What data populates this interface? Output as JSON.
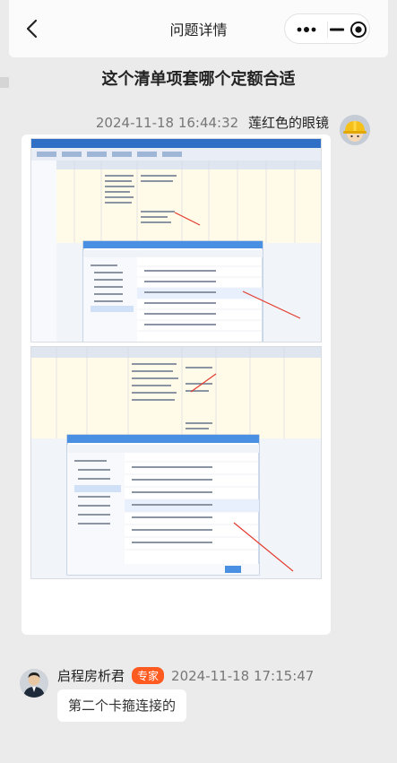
{
  "navbar": {
    "title": "问题详情",
    "back_icon": "chevron-left-icon",
    "more_icon": "more-dots-icon",
    "minimize_icon": "minus-icon",
    "close_icon": "target-circle-icon"
  },
  "question": {
    "title": "这个清单项套哪个定额合适"
  },
  "messages": [
    {
      "timestamp": "2024-11-18 16:44:32",
      "author": "莲红色的眼镜",
      "avatar_icon": "hardhat-avatar-icon",
      "attachment": "image"
    },
    {
      "author": "启程房析君",
      "badge": "专家",
      "timestamp": "2024-11-18 17:15:47",
      "avatar_icon": "person-avatar-icon",
      "text": "第二个卡箍连接的"
    }
  ],
  "colors": {
    "accent": "#ff5a1f",
    "page_bg": "#ebebeb",
    "card_bg": "#ffffff",
    "screenshot_blue": "#4a90e2",
    "arrow_red": "#e33b2f"
  }
}
